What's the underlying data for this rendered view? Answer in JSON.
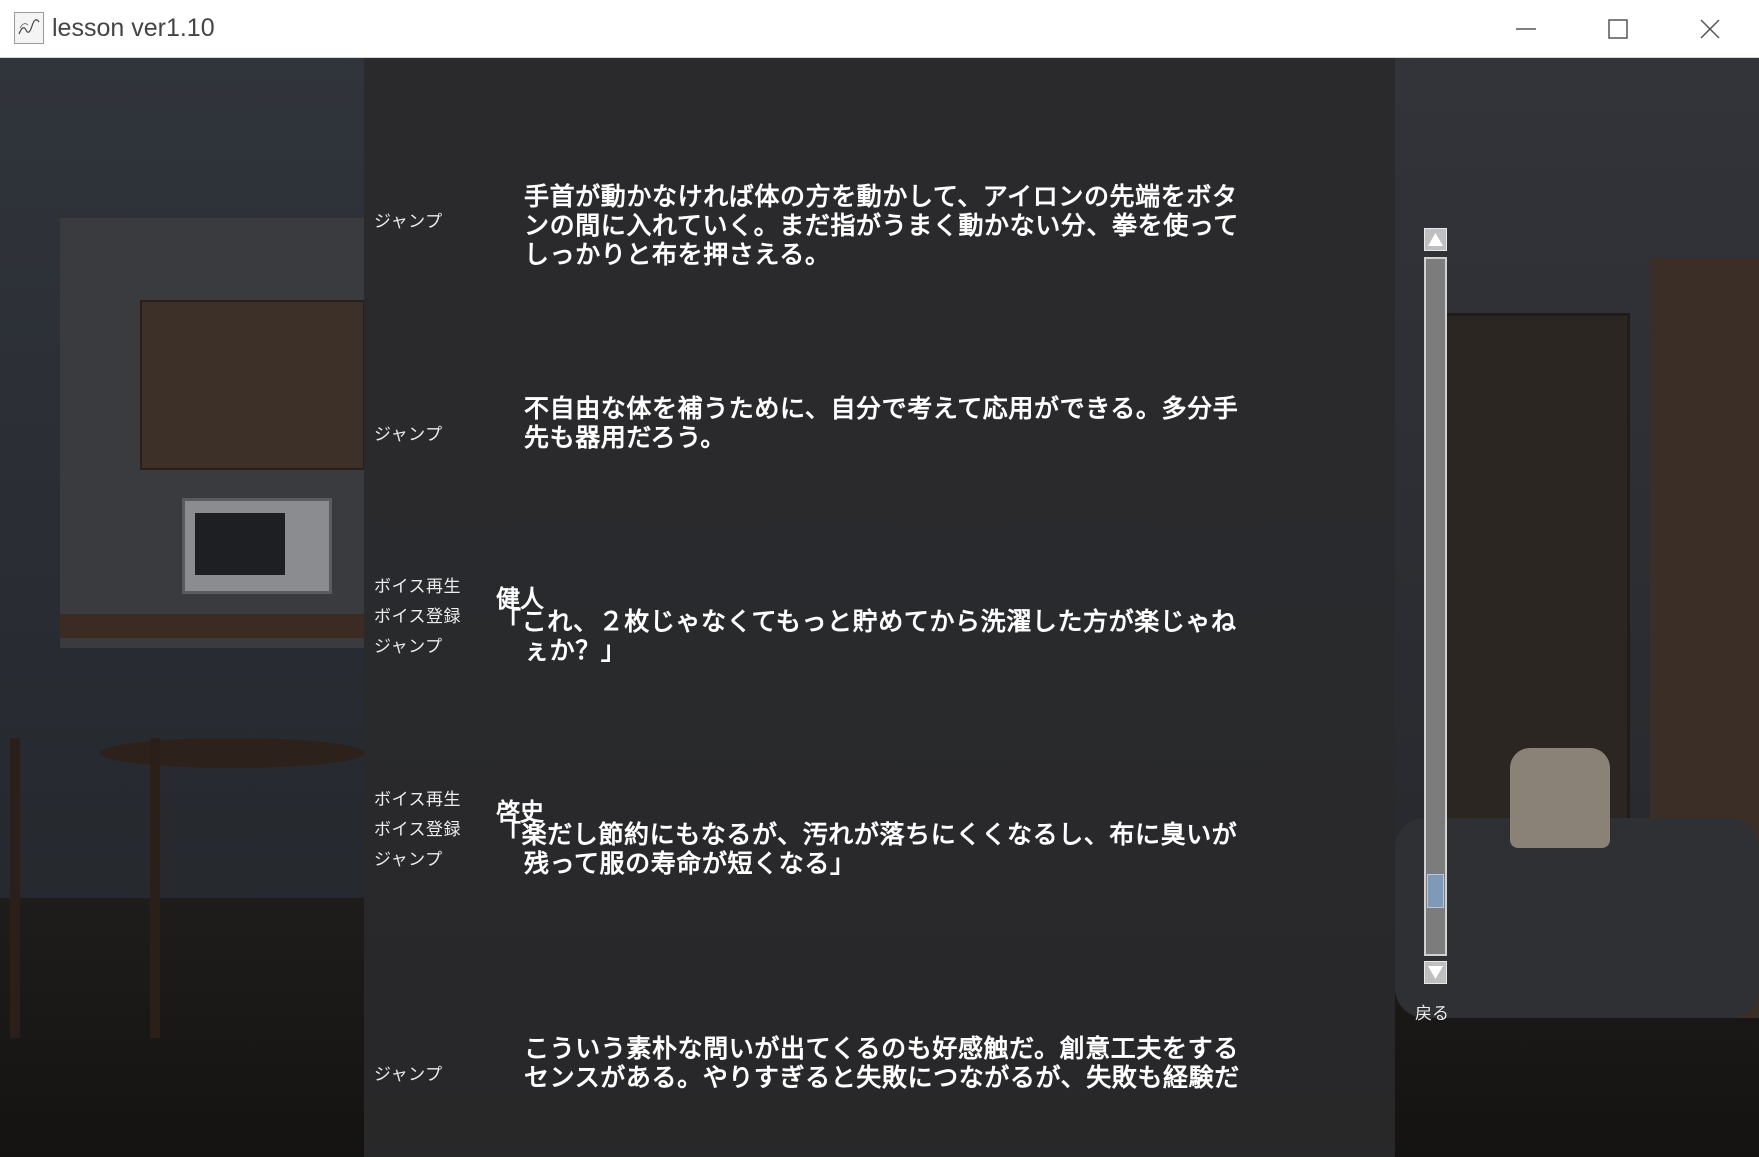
{
  "window": {
    "title": "lesson ver1.10",
    "icon_text": "lesson"
  },
  "backlog": {
    "entries": [
      {
        "buttons": [
          "ジャンプ"
        ],
        "speaker": "",
        "lines": [
          "手首が動かなければ体の方を動かして、アイロンの先端をボタ",
          "ンの間に入れていく。まだ指がうまく動かない分、拳を使って",
          "しっかりと布を押さえる。"
        ]
      },
      {
        "buttons": [
          "ジャンプ"
        ],
        "speaker": "",
        "lines": [
          "不自由な体を補うために、自分で考えて応用ができる。多分手",
          "先も器用だろう。"
        ]
      },
      {
        "buttons": [
          "ボイス再生",
          "ボイス登録",
          "ジャンプ"
        ],
        "speaker": "健人",
        "lines": [
          "「これ、２枚じゃなくてもっと貯めてから洗濯した方が楽じゃね",
          "ぇか？」"
        ]
      },
      {
        "buttons": [
          "ボイス再生",
          "ボイス登録",
          "ジャンプ"
        ],
        "speaker": "啓史",
        "lines": [
          "「楽だし節約にもなるが、汚れが落ちにくくなるし、布に臭いが",
          "残って服の寿命が短くなる」"
        ]
      },
      {
        "buttons": [
          "ジャンプ"
        ],
        "speaker": "",
        "lines": [
          "こういう素朴な問いが出てくるのも好感触だ。創意工夫をする",
          "センスがある。やりすぎると失敗につながるが、失敗も経験だ"
        ]
      }
    ]
  },
  "scrollbar": {
    "position": 0.93
  },
  "back_label": "戻る",
  "colors": {
    "panel": "#2a2a2c",
    "text": "#ffffff",
    "scroll_thumb": "#7f99b8"
  }
}
